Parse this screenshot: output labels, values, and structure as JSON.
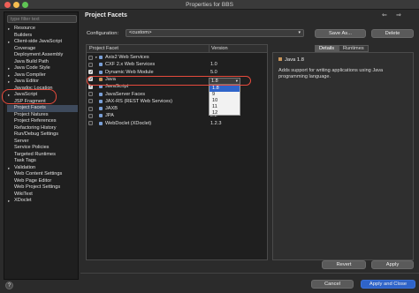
{
  "window": {
    "title": "Properties for BBS"
  },
  "filter": {
    "placeholder": "type filter text"
  },
  "tree": [
    {
      "label": "Resource",
      "twisty": "▸"
    },
    {
      "label": "Builders",
      "twisty": ""
    },
    {
      "label": "Client-side JavaScript",
      "twisty": "▸"
    },
    {
      "label": "Coverage",
      "twisty": ""
    },
    {
      "label": "Deployment Assembly",
      "twisty": ""
    },
    {
      "label": "Java Build Path",
      "twisty": ""
    },
    {
      "label": "Java Code Style",
      "twisty": "▸"
    },
    {
      "label": "Java Compiler",
      "twisty": "▸"
    },
    {
      "label": "Java Editor",
      "twisty": "▸"
    },
    {
      "label": "Javadoc Location",
      "twisty": ""
    },
    {
      "label": "JavaScript",
      "twisty": "▸"
    },
    {
      "label": "JSP Fragment",
      "twisty": ""
    },
    {
      "label": "Project Facets",
      "twisty": "",
      "selected": true
    },
    {
      "label": "Project Natures",
      "twisty": ""
    },
    {
      "label": "Project References",
      "twisty": ""
    },
    {
      "label": "Refactoring History",
      "twisty": ""
    },
    {
      "label": "Run/Debug Settings",
      "twisty": ""
    },
    {
      "label": "Server",
      "twisty": ""
    },
    {
      "label": "Service Policies",
      "twisty": ""
    },
    {
      "label": "Targeted Runtimes",
      "twisty": ""
    },
    {
      "label": "Task Tags",
      "twisty": ""
    },
    {
      "label": "Validation",
      "twisty": "▸"
    },
    {
      "label": "Web Content Settings",
      "twisty": ""
    },
    {
      "label": "Web Page Editor",
      "twisty": ""
    },
    {
      "label": "Web Project Settings",
      "twisty": ""
    },
    {
      "label": "WikiText",
      "twisty": ""
    },
    {
      "label": "XDoclet",
      "twisty": "▸"
    }
  ],
  "page": {
    "title": "Project Facets",
    "nav_back": "⇐",
    "nav_fwd": "⇒"
  },
  "configuration": {
    "label": "Configuration:",
    "value": "<custom>",
    "save_as": "Save As...",
    "delete": "Delete"
  },
  "facets": {
    "col_facet": "Project Facet",
    "col_version": "Version",
    "rows": [
      {
        "name": "Axis2 Web Services",
        "version": "",
        "checked": false,
        "twisty": "▸",
        "color": "#7aa0d8"
      },
      {
        "name": "CXF 2.x Web Services",
        "version": "1.0",
        "checked": false,
        "twisty": "",
        "color": "#7aa0d8"
      },
      {
        "name": "Dynamic Web Module",
        "version": "5.0",
        "checked": true,
        "twisty": "",
        "color": "#7aa0d8"
      },
      {
        "name": "Java",
        "version": "",
        "checked": true,
        "twisty": "",
        "color": "#c8955a"
      },
      {
        "name": "JavaScript",
        "version": "",
        "checked": true,
        "twisty": "",
        "color": "#7aa0d8"
      },
      {
        "name": "JavaServer Faces",
        "version": "",
        "checked": false,
        "twisty": "",
        "color": "#7aa0d8"
      },
      {
        "name": "JAX-RS (REST Web Services)",
        "version": "",
        "checked": false,
        "twisty": "",
        "color": "#7aa0d8"
      },
      {
        "name": "JAXB",
        "version": "",
        "checked": false,
        "twisty": "",
        "color": "#7aa0d8"
      },
      {
        "name": "JPA",
        "version": "2.2",
        "checked": false,
        "twisty": "",
        "color": "#7aa0d8"
      },
      {
        "name": "WebDoclet (XDoclet)",
        "version": "1.2.3",
        "checked": false,
        "twisty": "",
        "color": "#7aa0d8"
      }
    ]
  },
  "version_dropdown": {
    "value": "1.8",
    "options": [
      "1.8",
      "9",
      "10",
      "11",
      "12"
    ],
    "highlighted": "1.8"
  },
  "details": {
    "tabs": [
      "Details",
      "Runtimes"
    ],
    "active_tab": "Details",
    "title": "Java 1.8",
    "description": "Adds support for writing applications using Java programming language."
  },
  "buttons": {
    "revert": "Revert",
    "apply": "Apply",
    "cancel": "Cancel",
    "apply_close": "Apply and Close",
    "help": "?"
  },
  "colors": {
    "accent": "#2f64c9",
    "highlight_ring": "#e64a3c"
  }
}
